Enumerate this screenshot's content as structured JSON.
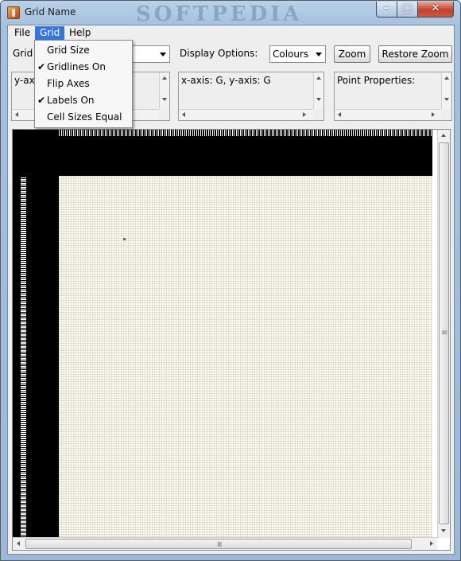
{
  "window": {
    "title": "Grid Name",
    "watermark": "SOFTPEDIA",
    "controls": {
      "minimize": "–",
      "maximize": "□",
      "close": "✕"
    }
  },
  "menubar": {
    "file": "File",
    "grid": "Grid",
    "help": "Help"
  },
  "grid_menu": {
    "items": [
      {
        "label": "Grid Size",
        "checked": false
      },
      {
        "label": "Gridlines On",
        "checked": true
      },
      {
        "label": "Flip Axes",
        "checked": false
      },
      {
        "label": "Labels On",
        "checked": true
      },
      {
        "label": "Cell Sizes Equal",
        "checked": false
      }
    ],
    "check_glyph": "✔"
  },
  "toolbar": {
    "grid_label": "Grid",
    "grid_combo_value": "",
    "display_options_label": "Display Options:",
    "display_combo_value": "Colours",
    "zoom_button": "Zoom",
    "restore_zoom_button": "Restore Zoom"
  },
  "panes": {
    "axis_left": "y-axis",
    "axis_center": "x-axis: G, y-axis: G",
    "point_properties": "Point Properties:"
  },
  "scrollbar": {
    "grip": "≡"
  },
  "colors": {
    "menu_highlight": "#3875d7",
    "grid_background": "#fffdf2",
    "axis_band": "#000000"
  }
}
